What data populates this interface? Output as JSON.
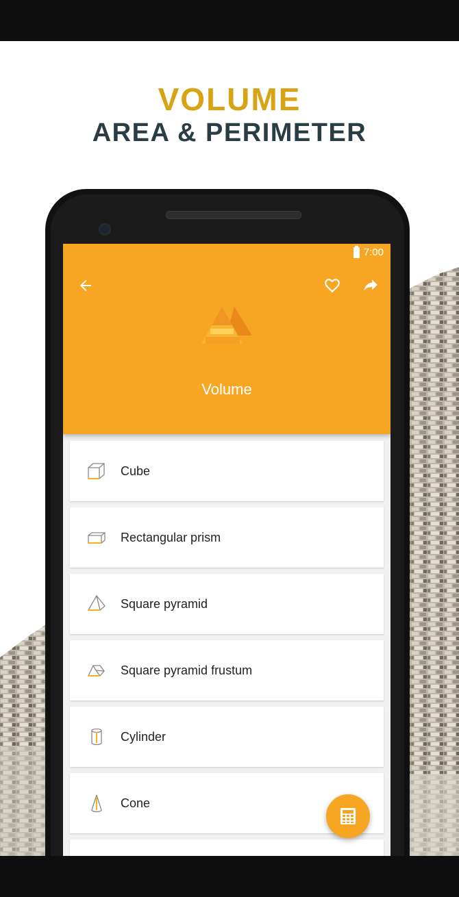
{
  "promo": {
    "headline_primary": "VOLUME",
    "headline_secondary": "AREA & PERIMETER"
  },
  "status_bar": {
    "time": "7:00",
    "battery_icon": "battery-full-icon"
  },
  "app_bar": {
    "back_icon": "arrow-back-icon",
    "favorite_icon": "heart-outline-icon",
    "share_icon": "share-arrow-icon",
    "header_icon": "pyramid-icon",
    "title": "Volume"
  },
  "list": {
    "items": [
      {
        "label": "Cube",
        "icon": "cube-icon"
      },
      {
        "label": "Rectangular prism",
        "icon": "rectangular-prism-icon"
      },
      {
        "label": "Square pyramid",
        "icon": "square-pyramid-icon"
      },
      {
        "label": "Square pyramid frustum",
        "icon": "pyramid-frustum-icon"
      },
      {
        "label": "Cylinder",
        "icon": "cylinder-icon"
      },
      {
        "label": "Cone",
        "icon": "cone-icon"
      }
    ]
  },
  "fab": {
    "icon": "calculator-icon"
  },
  "colors": {
    "accent": "#f6a623",
    "headline_gold": "#d9a316",
    "headline_dark": "#2b3d44",
    "icon_highlight": "#f2b21c"
  }
}
